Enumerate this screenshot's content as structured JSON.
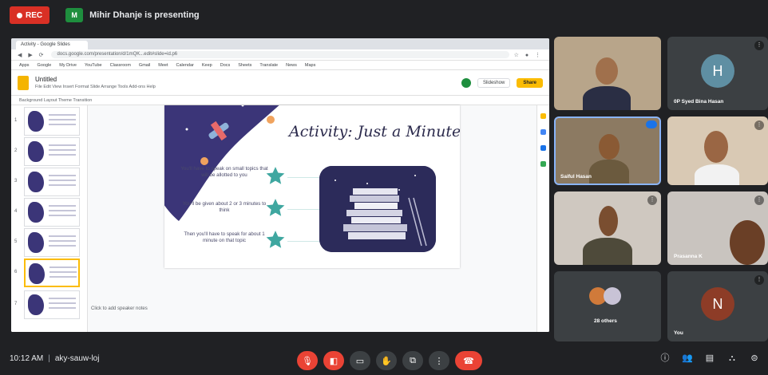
{
  "topbar": {
    "rec_label": "REC",
    "presenter_initial": "M",
    "presenting_text": "Mihir Dhanje is presenting"
  },
  "browser": {
    "tab_title": "Activity - Google Slides",
    "url": "docs.google.com/presentation/d/1mQK...edit#slide=id.p6",
    "bookmarks": [
      "Apps",
      "Google",
      "My Drive",
      "YouTube",
      "Classroom",
      "Gmail",
      "Meet",
      "Calendar",
      "Keep",
      "Docs",
      "Sheets",
      "Translate",
      "News",
      "Maps"
    ]
  },
  "slides_app": {
    "doc_title": "Untitled",
    "menu": "File  Edit  View  Insert  Format  Slide  Arrange  Tools  Add-ons  Help",
    "present_label": "Slideshow",
    "share_label": "Share",
    "toolbar_text": "Background   Layout   Theme   Transition",
    "thumb_numbers": [
      "1",
      "2",
      "3",
      "4",
      "5",
      "6",
      "7"
    ],
    "speaker_notes": "Click to add speaker notes"
  },
  "slide": {
    "title": "Activity: Just a Minute",
    "bullets": [
      "You'll have to speak on small topics that will be allotted to you",
      "You'll be given about 2 or 3 minutes to think",
      "Then you'll have to speak for about 1 minute on that topic"
    ]
  },
  "participants": [
    {
      "name": "",
      "initial": ""
    },
    {
      "name": "0P Syed Bina Hasan",
      "initial": "H",
      "color": "#5f8fa3"
    },
    {
      "name": "Saiful Hasan",
      "initial": ""
    },
    {
      "name": "",
      "initial": ""
    },
    {
      "name": "",
      "initial": ""
    },
    {
      "name": "Prasanna K",
      "initial": ""
    },
    {
      "name": "28 others",
      "initial": ""
    },
    {
      "name": "You",
      "initial": "N",
      "color": "#8d3c27"
    }
  ],
  "bottombar": {
    "time": "10:12 AM",
    "meeting_code": "aky-sauw-loj"
  },
  "colors": {
    "background": "#202124",
    "end_call": "#ea4335",
    "whale": "#3b3578",
    "star": "#3fa7a0"
  },
  "icons": {
    "controls": [
      "mic-off-icon",
      "camera-off-icon",
      "captions-icon",
      "raise-hand-icon",
      "present-icon",
      "more-icon",
      "end-call-icon"
    ],
    "right": [
      "info-icon",
      "people-icon",
      "chat-icon",
      "activities-icon",
      "lock-icon"
    ]
  }
}
